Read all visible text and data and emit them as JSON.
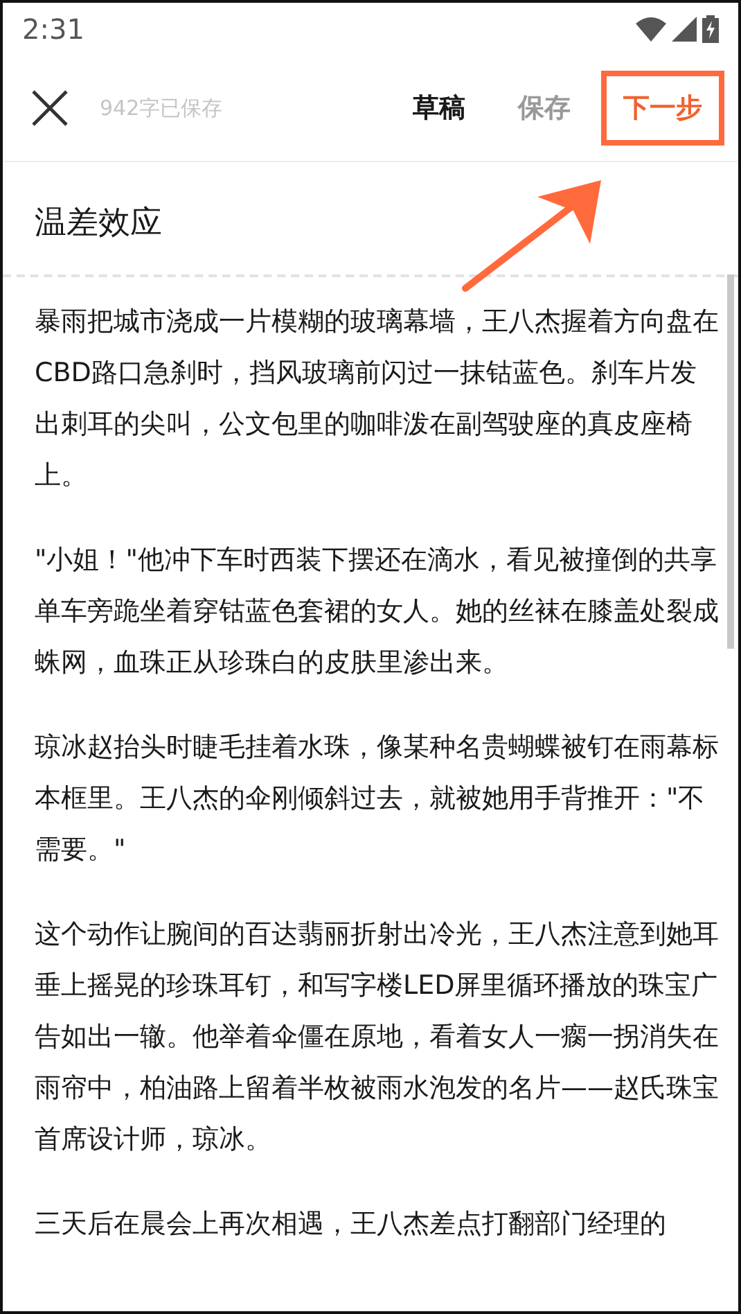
{
  "status_bar": {
    "time": "2:31"
  },
  "toolbar": {
    "saved_status": "942字已保存",
    "actions": [
      {
        "label": "草稿",
        "kind": "draft",
        "highlighted": false
      },
      {
        "label": "保存",
        "kind": "save",
        "highlighted": false
      },
      {
        "label": "下一步",
        "kind": "next",
        "highlighted": true
      }
    ]
  },
  "title": "温差效应",
  "paragraphs": [
    "暴雨把城市浇成一片模糊的玻璃幕墙，王八杰握着方向盘在CBD路口急刹时，挡风玻璃前闪过一抹钴蓝色。刹车片发出刺耳的尖叫，公文包里的咖啡泼在副驾驶座的真皮座椅上。",
    "\"小姐！\"他冲下车时西装下摆还在滴水，看见被撞倒的共享单车旁跪坐着穿钴蓝色套裙的女人。她的丝袜在膝盖处裂成蛛网，血珠正从珍珠白的皮肤里渗出来。",
    "琼冰赵抬头时睫毛挂着水珠，像某种名贵蝴蝶被钉在雨幕标本框里。王八杰的伞刚倾斜过去，就被她用手背推开：\"不需要。\"",
    "这个动作让腕间的百达翡丽折射出冷光，王八杰注意到她耳垂上摇晃的珍珠耳钉，和写字楼LED屏里循环播放的珠宝广告如出一辙。他举着伞僵在原地，看着女人一瘸一拐消失在雨帘中，柏油路上留着半枚被雨水泡发的名片——赵氏珠宝首席设计师，琼冰。",
    "三天后在晨会上再次相遇，王八杰差点打翻部门经理的"
  ]
}
